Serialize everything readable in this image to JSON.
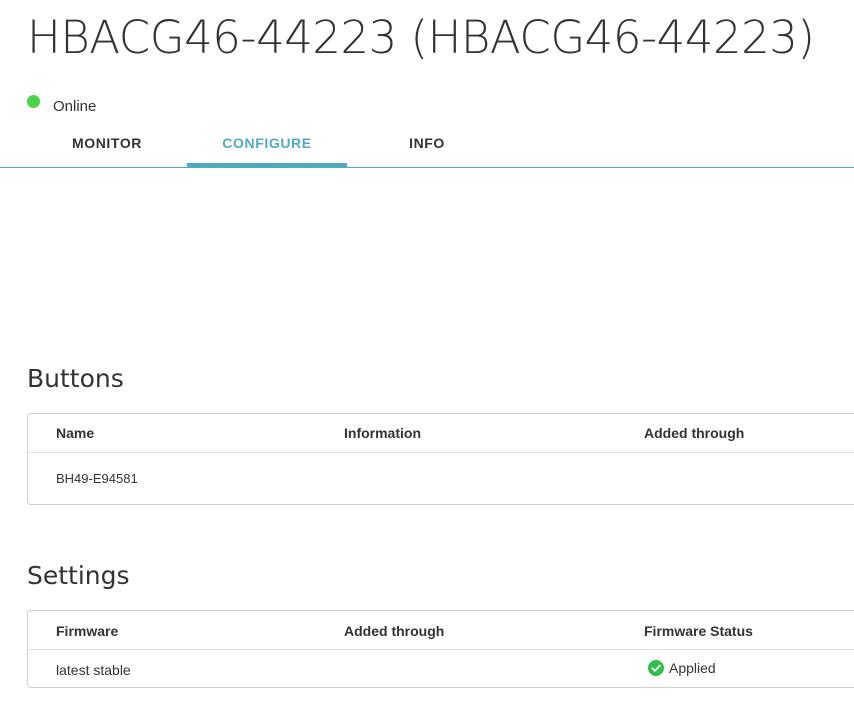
{
  "device": {
    "title": "HBACG46-44223 (HBACG46-44223)",
    "status": {
      "text": "Online",
      "color": "#4cd34c"
    }
  },
  "tabs": [
    {
      "label": "MONITOR",
      "active": false
    },
    {
      "label": "CONFIGURE",
      "active": true
    },
    {
      "label": "INFO",
      "active": false
    }
  ],
  "colors": {
    "accent": "#4fa9bf",
    "success": "#2fbf4a"
  },
  "buttons_section": {
    "title": "Buttons",
    "columns": [
      "Name",
      "Information",
      "Added through"
    ],
    "rows": [
      {
        "name": "BH49-E94581",
        "information": "",
        "added_through": ""
      }
    ]
  },
  "settings_section": {
    "title": "Settings",
    "columns": [
      "Firmware",
      "Added through",
      "Firmware Status"
    ],
    "rows": [
      {
        "firmware": "latest stable",
        "added_through": "",
        "status": "Applied",
        "status_icon": "check-circle-icon"
      }
    ]
  }
}
